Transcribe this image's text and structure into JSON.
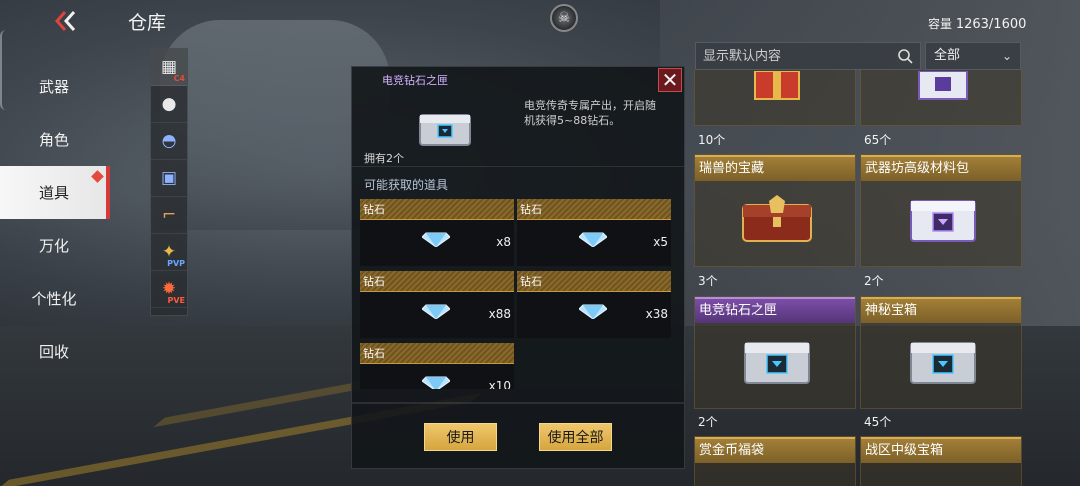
{
  "header": {
    "back_icon": "double-chevron-left-icon",
    "title": "仓库",
    "capacity_label": "容量",
    "capacity_value": "1263/1600"
  },
  "sidebar": {
    "items": [
      {
        "label": "武器"
      },
      {
        "label": "角色"
      },
      {
        "label": "道具",
        "active": true
      },
      {
        "label": "万化"
      },
      {
        "label": "个性化"
      },
      {
        "label": "回收"
      }
    ]
  },
  "icon_strip": {
    "items": [
      {
        "icon": "c4-explosive-icon",
        "tag": "C4"
      },
      {
        "icon": "grenade-icon",
        "tag": ""
      },
      {
        "icon": "helmet-icon",
        "tag": ""
      },
      {
        "icon": "armor-vest-icon",
        "tag": ""
      },
      {
        "icon": "pistol-icon",
        "tag": ""
      },
      {
        "icon": "wings-icon",
        "tag": "PVP"
      },
      {
        "icon": "flame-icon",
        "tag": "PVE"
      }
    ]
  },
  "detail": {
    "name": "电竞钻石之匣",
    "description": "电竞传奇专属产出，开启随机获得5~88钻石。",
    "owned": "拥有2个",
    "loot_title": "可能获取的道具",
    "loot": [
      {
        "label": "钻石",
        "qty": "x8"
      },
      {
        "label": "钻石",
        "qty": "x5"
      },
      {
        "label": "钻石",
        "qty": "x88"
      },
      {
        "label": "钻石",
        "qty": "x38"
      },
      {
        "label": "钻石",
        "qty": "x10"
      }
    ],
    "use_label": "使用",
    "use_all_label": "使用全部"
  },
  "search": {
    "placeholder": "显示默认内容"
  },
  "filter": {
    "selected": "全部"
  },
  "inventory": {
    "items": [
      {
        "name": "",
        "count": "10个",
        "style": "gold",
        "image": "red-gift-box"
      },
      {
        "name": "",
        "count": "65个",
        "style": "gold",
        "image": "purple-crate"
      },
      {
        "name": "瑞兽的宝藏",
        "count": "3个",
        "style": "gold",
        "image": "dragon-chest"
      },
      {
        "name": "武器坊高级材料包",
        "count": "2个",
        "style": "gold",
        "image": "purple-crate"
      },
      {
        "name": "电竞钻石之匣",
        "count": "2个",
        "style": "purple",
        "image": "silver-case"
      },
      {
        "name": "神秘宝箱",
        "count": "45个",
        "style": "gold",
        "image": "silver-case"
      },
      {
        "name": "赏金币福袋",
        "count": "",
        "style": "gold",
        "image": ""
      },
      {
        "name": "战区中级宝箱",
        "count": "",
        "style": "gold",
        "image": ""
      }
    ]
  },
  "colors": {
    "accent_gold": "#d6a53f",
    "accent_red": "#d5393a",
    "purple_label": "#7b4ea6"
  }
}
